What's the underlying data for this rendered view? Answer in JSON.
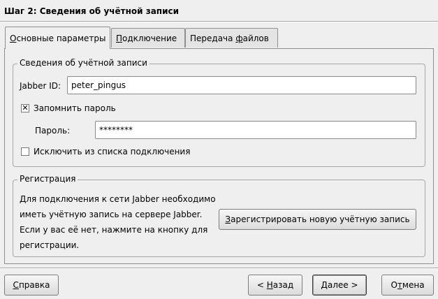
{
  "wizard": {
    "title": "Шаг 2: Сведения об учётной записи"
  },
  "tabs": [
    {
      "first": "О",
      "rest": "сновные параметры"
    },
    {
      "first": "П",
      "rest": "одключение"
    },
    {
      "first": "Передача ",
      "u": "ф",
      "rest": "айлов"
    }
  ],
  "account": {
    "group_title": "Сведения об учётной записи",
    "jid_label_u": "J",
    "jid_label_rest": "abber ID:",
    "jid_value": "peter_pingus",
    "remember_label": "Запомнить пароль",
    "remember_checked": true,
    "password_label": "Пароль:",
    "password_value": "********",
    "exclude_label": "Исключить из списка подключения",
    "exclude_checked": false
  },
  "registration": {
    "group_title": "Регистрация",
    "info_lines": [
      "Для подключения к сети Jabber необходимо",
      "иметь учётную запись на сервере Jabber.",
      "Если у вас её нет, нажмите на кнопку для",
      "регистрации."
    ],
    "register_u": "З",
    "register_rest": "арегистрировать новую учётную запись"
  },
  "footer": {
    "help_u": "С",
    "help_rest": "правка",
    "back_pre": "< ",
    "back_u": "Н",
    "back_rest": "азад",
    "next_u": "Д",
    "next_rest": "алее >",
    "cancel_pre": "О",
    "cancel_u": "т",
    "cancel_rest": "мена"
  }
}
